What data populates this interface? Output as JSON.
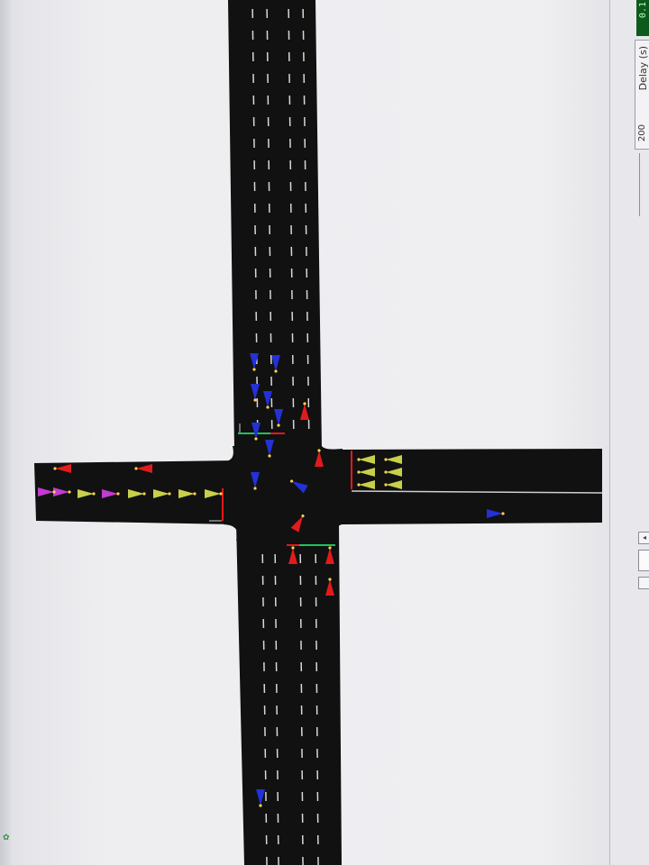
{
  "panel": {
    "status_text": "0.1",
    "delay_label": "Delay (s)",
    "delay_value": "200",
    "scroll_up": "▲",
    "scroll_down": "◂"
  },
  "sim": {
    "road_color": "#111111",
    "lane_marking_color": "#d8d8d8",
    "stop_line_red": "#e3181d",
    "stop_line_green": "#1ec35a",
    "vehicle_colors": {
      "red": "#e11b1b",
      "blue": "#2331d6",
      "yellow_green": "#c8d04a",
      "magenta": "#c43bcf"
    }
  }
}
